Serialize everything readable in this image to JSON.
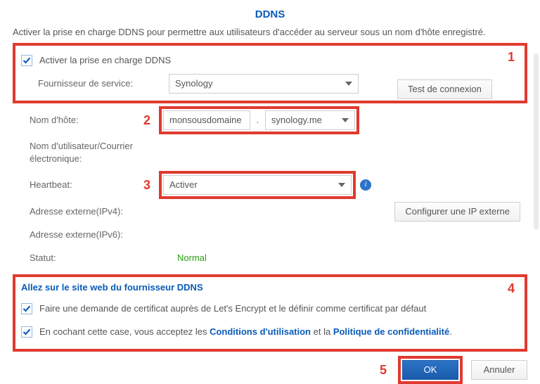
{
  "title": "DDNS",
  "intro": "Activer la prise en charge DDNS pour permettre aux utilisateurs d'accéder au serveur sous un nom d'hôte enregistré.",
  "section1": {
    "enable_label": "Activer la prise en charge DDNS",
    "provider_label": "Fournisseur de service:",
    "provider_value": "Synology",
    "test_btn": "Test de connexion",
    "callout": "1"
  },
  "row_host": {
    "label": "Nom d'hôte:",
    "callout": "2",
    "subdomain": "monsousdomaine",
    "domain": "synology.me"
  },
  "row_user": {
    "label": "Nom d'utilisateur/Courrier électronique:"
  },
  "row_heartbeat": {
    "label": "Heartbeat:",
    "callout": "3",
    "value": "Activer"
  },
  "row_ipv4": {
    "label": "Adresse externe(IPv4):",
    "btn": "Configurer une IP externe"
  },
  "row_ipv6": {
    "label": "Adresse externe(IPv6):"
  },
  "row_status": {
    "label": "Statut:",
    "value": "Normal"
  },
  "section4": {
    "callout": "4",
    "title": "Allez sur le site web du fournisseur DDNS",
    "opt1": "Faire une demande de certificat auprès de Let's Encrypt et le définir comme certificat par défaut",
    "opt2_a": "En cochant cette case, vous acceptez les ",
    "opt2_link1": "Conditions d'utilisation",
    "opt2_b": " et la ",
    "opt2_link2": "Politique de confidentialité",
    "opt2_c": "."
  },
  "footer": {
    "callout": "5",
    "ok": "OK",
    "cancel": "Annuler"
  }
}
